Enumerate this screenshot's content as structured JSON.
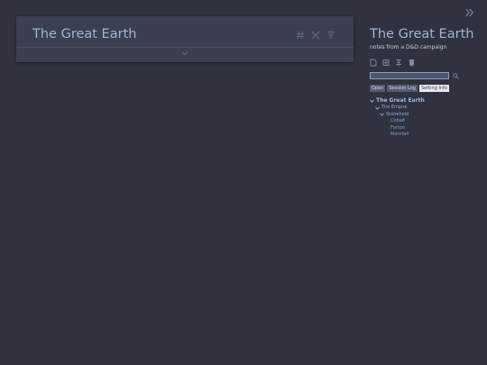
{
  "tiddler": {
    "title": "The Great Earth"
  },
  "sidebar": {
    "title": "The Great Earth",
    "subtitle": "notes from a D&D campaign",
    "search": {
      "value": "",
      "placeholder": ""
    },
    "tabs": [
      {
        "label": "Open",
        "selected": false
      },
      {
        "label": "Session Log",
        "selected": false
      },
      {
        "label": "Setting Info",
        "selected": true
      }
    ],
    "toc": {
      "root": "The Great Earth",
      "level1": "The Empire",
      "level2": "Stonehold",
      "leaves": [
        "Cobalt",
        "Forton",
        "Mornfall"
      ]
    }
  },
  "icons": {
    "tag": "hashtag-icon",
    "close": "close-icon",
    "close_others": "close-others-icon",
    "fold": "chevron-down-icon",
    "sidebar_toggle": "chevron-right-icon",
    "new": "new-tiddler-icon",
    "control_panel": "control-panel-icon",
    "fold_all": "fold-all-icon",
    "tag_manager": "tag-manager-icon",
    "search": "search-icon"
  },
  "colors": {
    "background": "#30333f",
    "tiddler_bg": "#3b3f50",
    "title": "#9fb4d8",
    "link": "#8ea9d3",
    "tab_bg": "#545b73",
    "tab_selected_bg": "#e6e8ee",
    "search_bg": "#4c556f"
  }
}
